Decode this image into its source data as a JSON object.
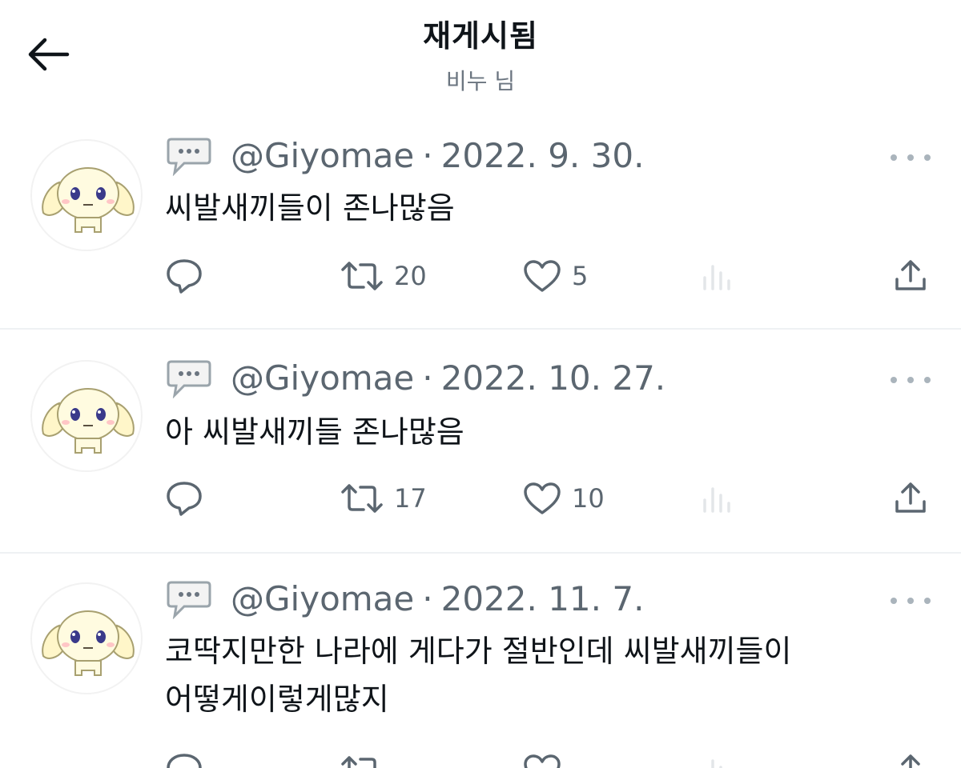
{
  "header": {
    "title": "재게시됨",
    "subtitle": "비누 님"
  },
  "posts": [
    {
      "handle": "@Giyomae",
      "separator": "·",
      "date": "2022. 9. 30.",
      "text": [
        "씨발새끼들이 존나많음"
      ],
      "retweets": "20",
      "likes": "5"
    },
    {
      "handle": "@Giyomae",
      "separator": "·",
      "date": "2022. 10. 27.",
      "text": [
        "아 씨발새끼들 존나많음"
      ],
      "retweets": "17",
      "likes": "10"
    },
    {
      "handle": "@Giyomae",
      "separator": "·",
      "date": "2022. 11. 7.",
      "text": [
        "코딱지만한 나라에 게다가 절반인데 씨발새끼들이",
        "어떻게이렇게많지"
      ],
      "retweets": "",
      "likes": ""
    }
  ],
  "icons": {
    "back": "arrow-left-icon",
    "post_type": "speech-bubble-icon",
    "more": "more-dots-icon",
    "reply": "reply-icon",
    "retweet": "retweet-icon",
    "like": "heart-icon",
    "views": "views-icon",
    "share": "share-icon"
  },
  "colors": {
    "text": "#0f1419",
    "muted": "#5b6670",
    "divider": "#eef1f3"
  }
}
